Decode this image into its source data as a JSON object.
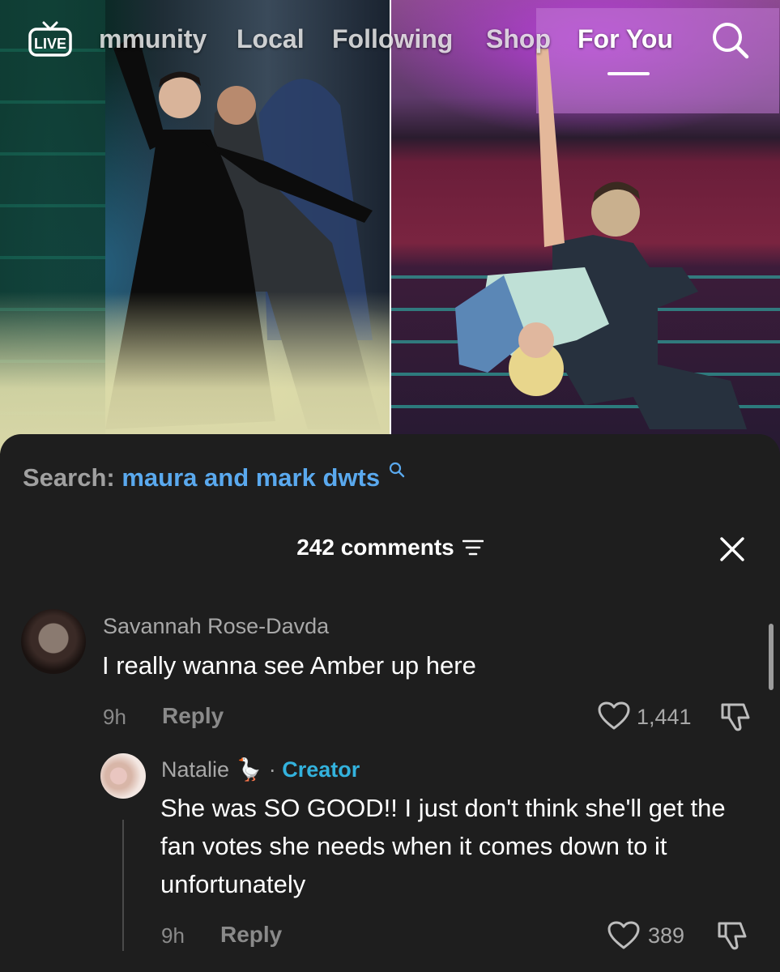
{
  "topnav": {
    "live_label": "LIVE",
    "tabs": [
      {
        "label": "mmunity",
        "active": false
      },
      {
        "label": "Local",
        "active": false
      },
      {
        "label": "Following",
        "active": false
      },
      {
        "label": "Shop",
        "active": false
      },
      {
        "label": "For You",
        "active": true
      }
    ],
    "search_icon": "search-icon"
  },
  "sheet": {
    "search_label": "Search:",
    "search_term": "maura and mark dwts",
    "comments_count_label": "242 comments",
    "sort_icon": "sort-icon",
    "close_icon": "close-icon"
  },
  "comments": [
    {
      "author": "Savannah Rose-Davda",
      "text": "I really wanna see Amber up here",
      "time": "9h",
      "reply_label": "Reply",
      "likes": "1,441"
    }
  ],
  "replies": [
    {
      "author": "Natalie",
      "emoji": "🪿",
      "separator": "·",
      "badge": "Creator",
      "text": "She was SO GOOD!! I just don't think she'll get the fan votes she needs when it comes down to it unfortunately",
      "time": "9h",
      "reply_label": "Reply",
      "likes": "389"
    }
  ],
  "colors": {
    "sheet_bg": "#1e1e1e",
    "search_term": "#5aa9ee",
    "creator_badge": "#33b2dd"
  }
}
